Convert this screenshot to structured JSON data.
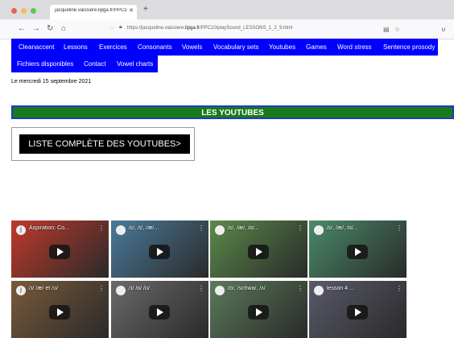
{
  "browser": {
    "tab_title": "jacqueline.vaissiere.lipga.fr/PPC10/p",
    "tab_close": "✕",
    "new_tab": "+",
    "nav": {
      "back": "←",
      "forward": "→",
      "reload": "↻",
      "home": "⌂"
    },
    "url_prefix": "https://jacqueline.vaissiere.",
    "url_domain": "lipga.fr",
    "url_path": "/PPC10/playSound_LESSONS_1_2_9.html",
    "reader_icon": "▤",
    "bookmark_icon": "☆",
    "pocket_icon": "⊍"
  },
  "menu_row1": [
    "Cleanaccent",
    "Lessons",
    "Exercices",
    "Consonants",
    "Vowels",
    "Vocabulary sets",
    "Youtubes",
    "Games",
    "Word stress",
    "Sentence prosody"
  ],
  "menu_row2": [
    "Fichiers disponibles",
    "Contact",
    "Vowel charts"
  ],
  "date_text": "Le mercredi 15 septembre 2021",
  "banner_title": "LES YOUTUBES",
  "list_button": "LISTE COMPLÈTE DES YOUTUBES>",
  "videos": [
    {
      "title": "Aspiration: Co...",
      "more": "⋮",
      "avatar": "j",
      "color": "#c0392b"
    },
    {
      "title": "/ɛ/, /ɪ/, /æ/...",
      "more": "⋮",
      "avatar": "",
      "color": "#4a7a9a"
    },
    {
      "title": "/ɛ/, /æ/, /ɑ/...",
      "more": "⋮",
      "avatar": "",
      "color": "#5a8a4a"
    },
    {
      "title": "/ɛ/, /æ/, /ɑ/...",
      "more": "⋮",
      "avatar": "",
      "color": "#4a8a6a"
    },
    {
      "title": "/ɪ/ /æ/ et /ʊ/",
      "more": "⋮",
      "avatar": "j",
      "color": "#7a5a3a"
    },
    {
      "title": "/ɪ/ /ɒ/ /ʊ/",
      "more": "⋮",
      "avatar": "",
      "color": "#6a6a6a"
    },
    {
      "title": "/ɒ/, /schwa/, /ʌ/",
      "more": "⋮",
      "avatar": "",
      "color": "#5a7a5a"
    },
    {
      "title": "lesson 4 ...",
      "more": "⋮",
      "avatar": "",
      "color": "#5a5a6a"
    }
  ]
}
